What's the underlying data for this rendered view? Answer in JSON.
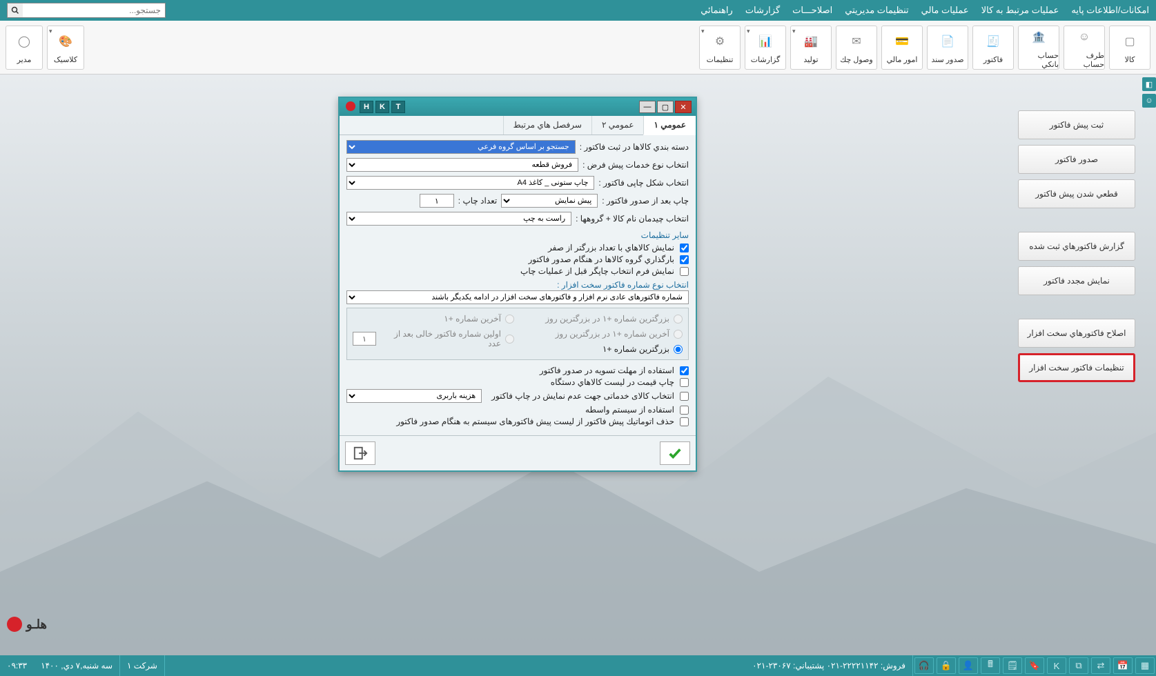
{
  "menubar": {
    "items": [
      "امکانات/اطلاعات پایه",
      "عملیات مرتبط به کالا",
      "عملیات مالي",
      "تنظیمات مدیریتي",
      "اصلاحـــات",
      "گزارشات",
      "راهنمائي"
    ],
    "search_placeholder": "جستجو..."
  },
  "ribbon": {
    "items": [
      {
        "label": "کالا",
        "icon": "box"
      },
      {
        "label": "طرف حساب",
        "icon": "user"
      },
      {
        "label": "حساب بانکي",
        "icon": "bank"
      },
      {
        "label": "فاکتور",
        "icon": "invoice"
      },
      {
        "label": "صدور سند",
        "icon": "doc"
      },
      {
        "label": "امور مالي",
        "icon": "money"
      },
      {
        "label": "وصول چك",
        "icon": "cheque"
      },
      {
        "label": "تولید",
        "icon": "factory",
        "dd": true
      },
      {
        "label": "گزارشات",
        "icon": "report",
        "dd": true
      },
      {
        "label": "تنظیمات",
        "icon": "gear",
        "dd": true
      }
    ],
    "right_items": [
      {
        "label": "کلاسیک",
        "icon": "palette",
        "dd": true
      },
      {
        "label": "مدیر",
        "icon": "admin"
      }
    ]
  },
  "side_buttons": [
    {
      "label": "ثبت پیش فاکتور",
      "type": "btn"
    },
    {
      "label": "صدور فاکتور",
      "type": "btn"
    },
    {
      "label": "قطعي شدن پيش فاكتور",
      "type": "btn"
    },
    {
      "type": "gap"
    },
    {
      "label": "گزارش فاکتورهاي ثبت شده",
      "type": "btn"
    },
    {
      "label": "نمايش مجدد فاكتور",
      "type": "btn"
    },
    {
      "type": "gap"
    },
    {
      "label": "اصلاح فاکتورهاي سخت افزار",
      "type": "btn"
    },
    {
      "label": "تنظیمات فاکتور سخت افزار",
      "type": "btn",
      "highlight": true
    }
  ],
  "dialog": {
    "title_tags": [
      "T",
      "K",
      "H"
    ],
    "tabs": [
      "عمومي ۱",
      "عمومي ۲",
      "سرفصل هاي مرتبط"
    ],
    "active_tab": 0,
    "row_type_classify_label": "دسته بندي کالاها در ثبت فاکتور :",
    "row_type_classify_value": "جستجو بر اساس گروه فرعي",
    "row_service_type_label": "انتخاب نوع خدمات پیش فرض :",
    "row_service_type_value": "فروش قطعه",
    "row_print_shape_label": "انتخاب شکل چاپی فاکتور :",
    "row_print_shape_value": "چاپ ستونی _ کاغذ A4",
    "row_after_print_label": "چاپ بعد از صدور فاكتور :",
    "row_after_print_value": "پیش نمایش",
    "row_copies_label": "تعداد چاپ :",
    "row_copies_value": "۱",
    "row_alignment_label": "انتخاب چیدمان نام کالا + گروهها :",
    "row_alignment_value": "راست به چپ",
    "other_settings_label": "ساير تنظيمات",
    "chk_gt_zero": "نمايش كالاهاي با تعداد بزرگتر از صفر",
    "chk_load_group": "بارگذاري گروه كالاها در هنگام صدور فاكتور",
    "chk_show_form": "نمايش فرم انتخاب چاپگر قبل از عمليات چاپ",
    "hw_number_label": "انتخاب نوع شماره فاکتور سخت افزار :",
    "hw_number_value": "شماره فاکتورهای عادی نرم افزار و فاکتورهای سخت افزار در ادامه یکدیگر باشند",
    "radio_group": {
      "r1": "بزرگترین شماره +۱ در بزرگترین روز",
      "r2": "آخرین شماره +۱",
      "r3": "آخرین شماره +۱ در بزرگترین روز",
      "r4": "اولین شماره فاکتور خالی بعد از عدد",
      "r4_input": "۱",
      "r5": "بزرگترین شماره +۱"
    },
    "chk_deadline": "استفاده از مهلت تسویه در صدور فاکتور",
    "chk_price_list": "چاپ قیمت در لیست کالاهاي دستگاه",
    "chk_service_noprint": "انتخاب کالای خدماتی جهت عدم نمایش در چاپ فاکتور",
    "service_noprint_value": "هزینه باربری",
    "chk_mediator": "استفاده از سیستم واسطه",
    "chk_autodelete": "حذف اتوماتيك پيش فاكتور از ليست پيش فاكتورهای سيستم به هنگام صدور فاكتور"
  },
  "statusbar": {
    "icons_count": 11,
    "sales_label": "فروش:",
    "sales_phone": "۰۲۱-۲۲۲۲۱۱۴۲",
    "support_label": "پشتیباني:",
    "support_phone": "۰۲۱-۲۳۰۶۷",
    "company": "شرکت ۱",
    "date": "سه شنبه,۷ دي, ۱۴۰۰",
    "time": "۰۹:۳۳"
  },
  "brand": "هلـو"
}
